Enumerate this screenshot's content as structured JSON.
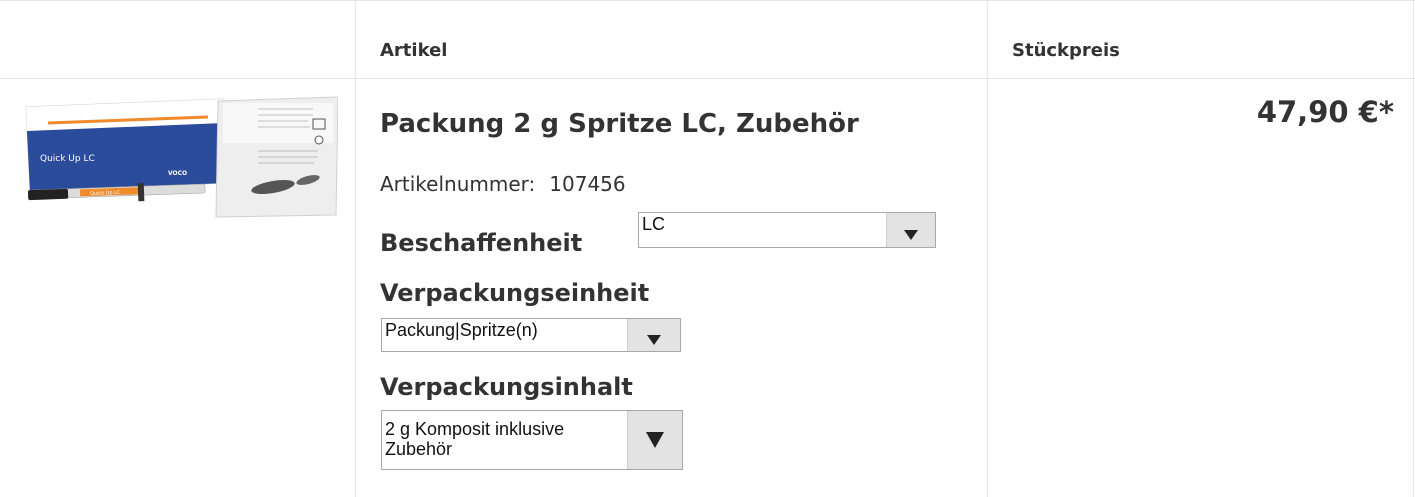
{
  "table": {
    "headers": {
      "image": "",
      "article": "Artikel",
      "unit_price": "Stückpreis"
    }
  },
  "product": {
    "title": "Packung 2 g Spritze LC, Zubehör",
    "article_number_label": "Artikelnummer:",
    "article_number_value": "107456",
    "image": {
      "box_brand": "Quick Up LC",
      "logo": "VOCO",
      "syringe_label": "Quick Up LC"
    },
    "price": "47,90 €*"
  },
  "options": {
    "beschaffenheit": {
      "label": "Beschaffenheit",
      "selected": "LC"
    },
    "verpackungseinheit": {
      "label": "Verpackungseinheit",
      "selected": "Packung|Spritze(n)"
    },
    "verpackungsinhalt": {
      "label": "Verpackungsinhalt",
      "selected_line1": "2 g Komposit inklusive",
      "selected_line2": "Zubehör"
    }
  },
  "colors": {
    "box_blue": "#2b4c9a",
    "grid": "#e6e6e6",
    "text": "#333333"
  },
  "icons": {
    "dropdown": "chevron-down-icon"
  }
}
